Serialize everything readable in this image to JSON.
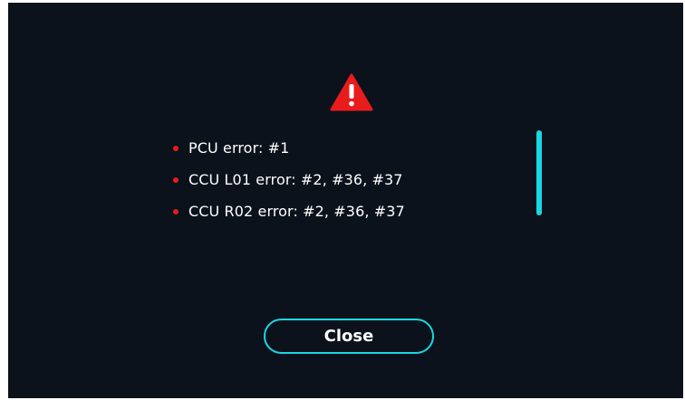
{
  "dialog": {
    "icon": "warning-triangle-icon",
    "errors": [
      "PCU error: #1",
      "CCU L01 error: #2, #36, #37",
      "CCU R02 error: #2, #36, #37"
    ],
    "close_label": "Close"
  },
  "colors": {
    "background": "#0b121b",
    "accent": "#1ad7e4",
    "warning": "#e81c1c",
    "text": "#ffffff"
  }
}
